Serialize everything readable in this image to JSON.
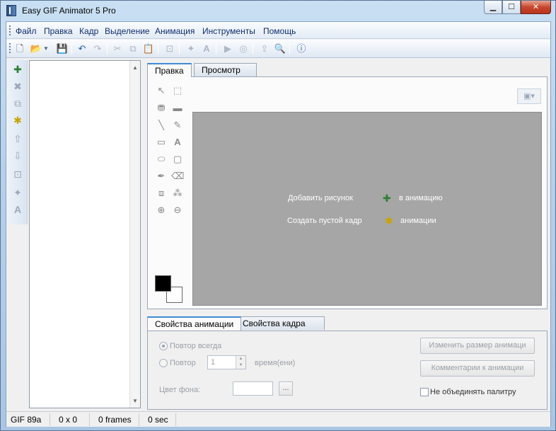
{
  "window": {
    "title": "Easy GIF Animator 5 Pro",
    "buttons": {
      "minimize": "▁",
      "maximize": "☐",
      "close": "✕"
    }
  },
  "menu": [
    "Файл",
    "Правка",
    "Кадр",
    "Выделение",
    "Анимация",
    "Инструменты",
    "Помощь"
  ],
  "toolbar": {
    "icons": [
      "new-icon",
      "open-icon",
      "dropdown-arrow-icon",
      "save-icon",
      "undo-icon",
      "redo-icon",
      "cut-icon",
      "copy-icon",
      "paste-icon",
      "resize-icon",
      "wizard-icon",
      "text-icon",
      "play-icon",
      "preview-icon",
      "export-icon",
      "search-icon",
      "help-icon"
    ]
  },
  "editor_tabs": {
    "edit": "Правка",
    "preview": "Просмотр"
  },
  "canvas": {
    "add_image": "Добавить рисунок",
    "add_image_target": "в анимацию",
    "create_frame": "Создать пустой кадр",
    "create_frame_target": "анимации"
  },
  "props_tabs": {
    "animation": "Свойства анимации",
    "frame": "Свойства кадра"
  },
  "props": {
    "repeat_forever": "Повтор всегда",
    "repeat": "Повтор",
    "repeat_count": "1",
    "times": "время(ени)",
    "bg_color": "Цвет фона:",
    "dots": "...",
    "resize_btn": "Изменить размер анимаци",
    "comments_btn": "Комментарии к анимации",
    "no_merge_palette": "Не объединять палитру"
  },
  "status": {
    "format": "GIF 89a",
    "size": "0 x 0",
    "frames": "0 frames",
    "time": "0 sec"
  },
  "colors": {
    "accent": "#3f8ad6",
    "canvas": "#a6a6a6",
    "foreground": "#000000",
    "background": "#ffffff"
  }
}
